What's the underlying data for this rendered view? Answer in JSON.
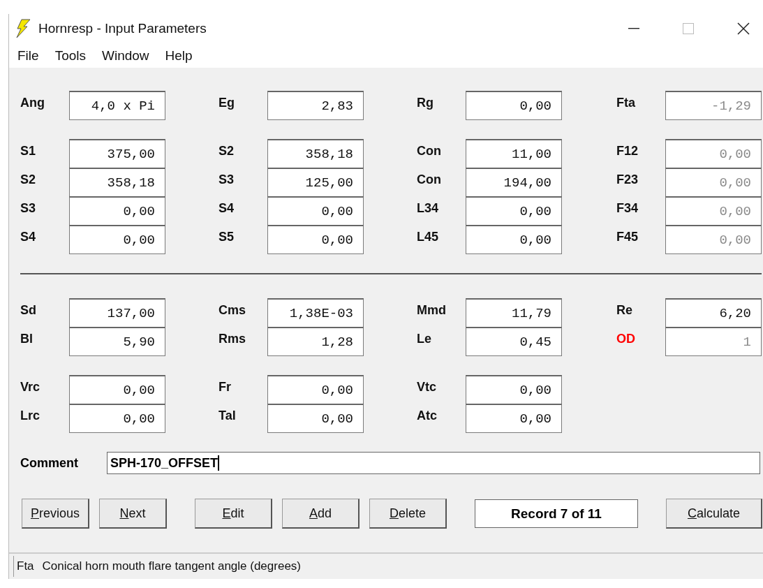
{
  "window": {
    "title": "Hornresp - Input Parameters"
  },
  "menu": [
    "File",
    "Tools",
    "Window",
    "Help"
  ],
  "groups": [
    {
      "rows": [
        [
          {
            "label": "Ang",
            "value": "4,0 x Pi",
            "disabled": false
          },
          {
            "label": "Eg",
            "value": "2,83",
            "disabled": false
          },
          {
            "label": "Rg",
            "value": "0,00",
            "disabled": false
          },
          {
            "label": "Fta",
            "value": "-1,29",
            "disabled": true
          }
        ]
      ]
    },
    {
      "rows": [
        [
          {
            "label": "S1",
            "value": "375,00",
            "disabled": false
          },
          {
            "label": "S2",
            "value": "358,18",
            "disabled": false
          },
          {
            "label": "Con",
            "value": "11,00",
            "disabled": false
          },
          {
            "label": "F12",
            "value": "0,00",
            "disabled": true
          }
        ],
        [
          {
            "label": "S2",
            "value": "358,18",
            "disabled": false
          },
          {
            "label": "S3",
            "value": "125,00",
            "disabled": false
          },
          {
            "label": "Con",
            "value": "194,00",
            "disabled": false
          },
          {
            "label": "F23",
            "value": "0,00",
            "disabled": true
          }
        ],
        [
          {
            "label": "S3",
            "value": "0,00",
            "disabled": false
          },
          {
            "label": "S4",
            "value": "0,00",
            "disabled": false
          },
          {
            "label": "L34",
            "value": "0,00",
            "disabled": false
          },
          {
            "label": "F34",
            "value": "0,00",
            "disabled": true
          }
        ],
        [
          {
            "label": "S4",
            "value": "0,00",
            "disabled": false
          },
          {
            "label": "S5",
            "value": "0,00",
            "disabled": false
          },
          {
            "label": "L45",
            "value": "0,00",
            "disabled": false
          },
          {
            "label": "F45",
            "value": "0,00",
            "disabled": true
          }
        ]
      ]
    },
    {
      "kind": "divider"
    },
    {
      "rows": [
        [
          {
            "label": "Sd",
            "value": "137,00",
            "disabled": false
          },
          {
            "label": "Cms",
            "value": "1,38E-03",
            "disabled": false
          },
          {
            "label": "Mmd",
            "value": "11,79",
            "disabled": false
          },
          {
            "label": "Re",
            "value": "6,20",
            "disabled": false
          }
        ],
        [
          {
            "label": "Bl",
            "value": "5,90",
            "disabled": false
          },
          {
            "label": "Rms",
            "value": "1,28",
            "disabled": false
          },
          {
            "label": "Le",
            "value": "0,45",
            "disabled": false
          },
          {
            "label": "OD",
            "value": "1",
            "disabled": true,
            "color": "#ff0000"
          }
        ]
      ]
    },
    {
      "rows": [
        [
          {
            "label": "Vrc",
            "value": "0,00",
            "disabled": false
          },
          {
            "label": "Fr",
            "value": "0,00",
            "disabled": false
          },
          {
            "label": "Vtc",
            "value": "0,00",
            "disabled": false
          }
        ],
        [
          {
            "label": "Lrc",
            "value": "0,00",
            "disabled": false
          },
          {
            "label": "Tal",
            "value": "0,00",
            "disabled": false
          },
          {
            "label": "Atc",
            "value": "0,00",
            "disabled": false
          }
        ]
      ]
    }
  ],
  "comment": {
    "label": "Comment",
    "value": "SPH-170_OFFSET"
  },
  "buttons": [
    {
      "label": "Previous",
      "kind": "button"
    },
    {
      "label": "Next",
      "kind": "button"
    },
    {
      "label": "Edit",
      "kind": "button"
    },
    {
      "label": "Add",
      "kind": "button"
    },
    {
      "label": "Delete",
      "kind": "button"
    },
    {
      "label": "Record 7 of 11",
      "kind": "record"
    },
    {
      "label": "Calculate",
      "kind": "button"
    }
  ],
  "status_bar": {
    "name": "Fta",
    "text": "Conical horn mouth flare tangent angle  (degrees)"
  }
}
